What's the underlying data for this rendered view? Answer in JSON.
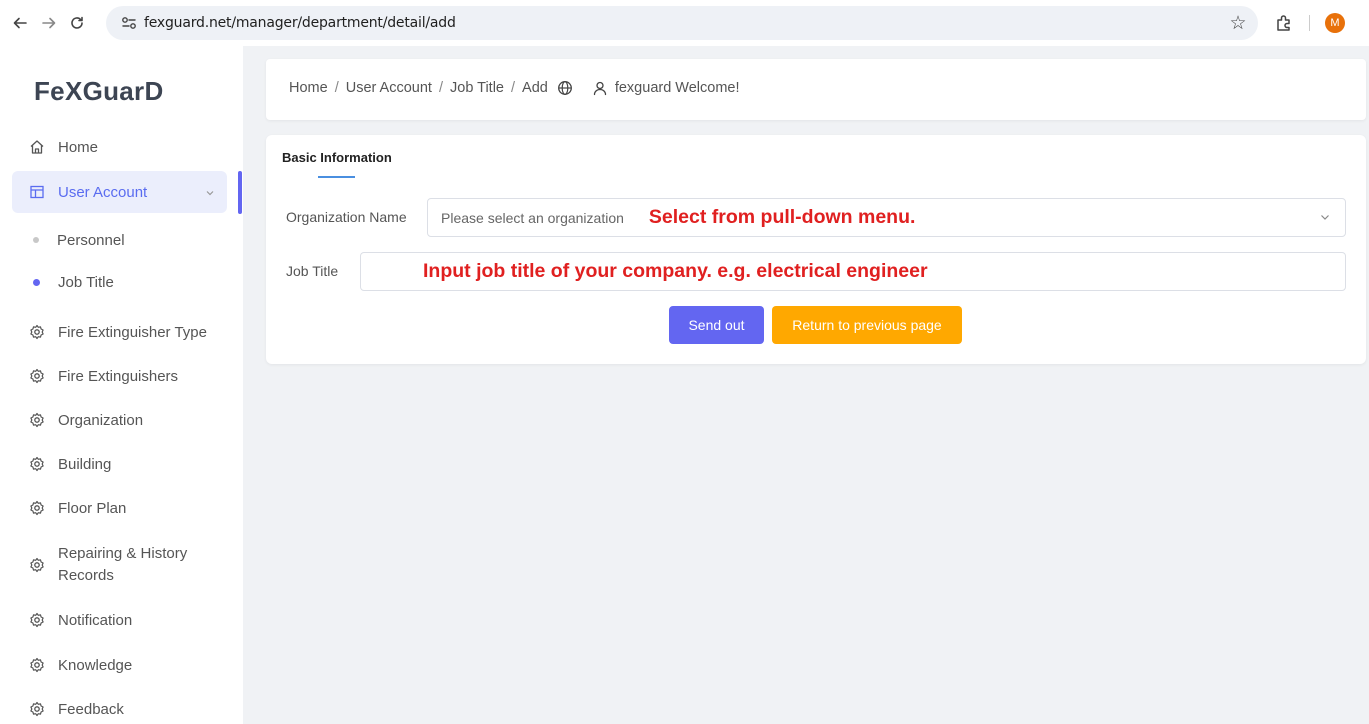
{
  "browser": {
    "url": "fexguard.net/manager/department/detail/add",
    "profile_initial": "M"
  },
  "sidebar": {
    "logo": "FeXGuarD",
    "items": [
      {
        "label": "Home",
        "icon": "home-icon"
      },
      {
        "label": "User Account",
        "icon": "layout-icon",
        "active": true,
        "expanded": true
      },
      {
        "label": "Personnel",
        "sub": true
      },
      {
        "label": "Job Title",
        "sub": true,
        "active": true
      },
      {
        "label": "Fire Extinguisher Type",
        "icon": "gear-icon"
      },
      {
        "label": "Fire Extinguishers",
        "icon": "gear-icon"
      },
      {
        "label": "Organization",
        "icon": "gear-icon"
      },
      {
        "label": "Building",
        "icon": "gear-icon"
      },
      {
        "label": "Floor Plan",
        "icon": "gear-icon"
      },
      {
        "label": "Repairing & History",
        "label2": "Records",
        "icon": "gear-icon"
      },
      {
        "label": "Notification",
        "icon": "gear-icon"
      },
      {
        "label": "Knowledge",
        "icon": "gear-icon"
      },
      {
        "label": "Feedback",
        "icon": "gear-icon"
      }
    ]
  },
  "header": {
    "breadcrumb": [
      "Home",
      "User Account",
      "Job Title",
      "Add"
    ],
    "separator": "/",
    "user_text": "fexguard Welcome!"
  },
  "form": {
    "section_title": "Basic Information",
    "org_label": "Organization Name",
    "org_placeholder": "Please select an organization",
    "org_annotation": "Select from pull-down menu.",
    "job_label": "Job Title",
    "job_annotation": "Input job title of your company.  e.g. electrical engineer",
    "send_label": "Send out",
    "return_label": "Return to previous page"
  },
  "colors": {
    "accent": "#6366f1",
    "return_button": "#ffa800",
    "annotation": "#e02020",
    "section_underline": "#4a8fe0"
  }
}
